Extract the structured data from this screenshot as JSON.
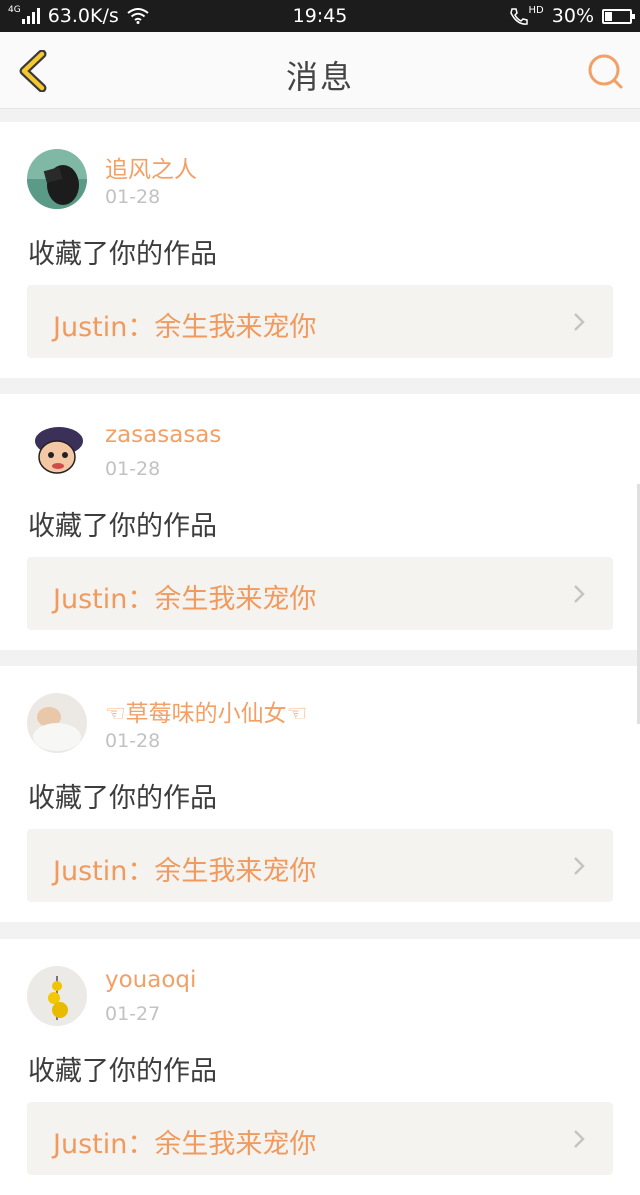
{
  "status_bar": {
    "network_type": "4G",
    "speed": "63.0K/s",
    "time": "19:45",
    "call_badge": "HD",
    "battery_percent": "30%",
    "battery_level": 0.3
  },
  "header": {
    "title": "消息",
    "back_icon": "chevron-left-icon",
    "search_icon": "search-icon",
    "accent_color": "#f3a066"
  },
  "messages": [
    {
      "user": "追风之人",
      "date": "01-28",
      "action": "收藏了你的作品",
      "work": "Justin：余生我来宠你"
    },
    {
      "user": "zasasasas",
      "date": "01-28",
      "action": "收藏了你的作品",
      "work": "Justin：余生我来宠你"
    },
    {
      "user": "☜草莓味的小仙女☜",
      "date": "01-28",
      "action": "收藏了你的作品",
      "work": "Justin：余生我来宠你"
    },
    {
      "user": "youaoqi",
      "date": "01-27",
      "action": "收藏了你的作品",
      "work": "Justin：余生我来宠你"
    }
  ]
}
